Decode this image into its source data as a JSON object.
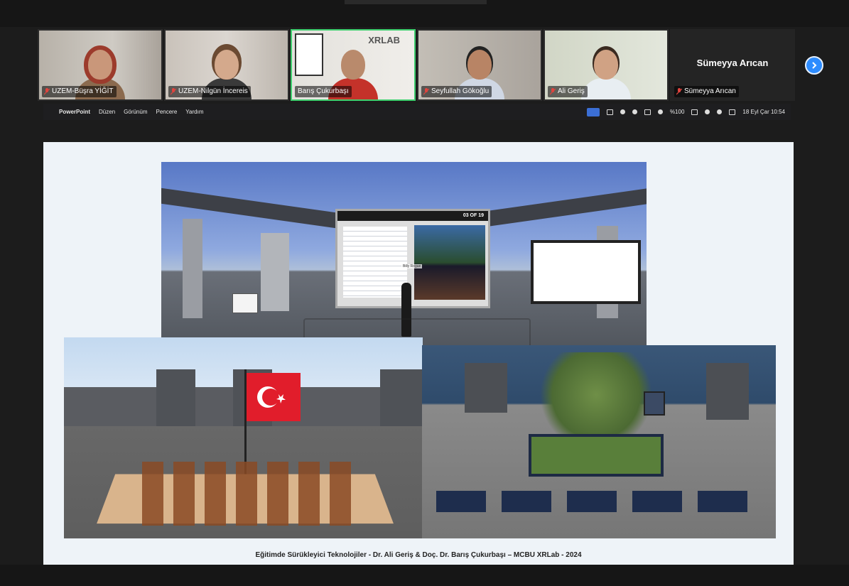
{
  "meeting": {
    "participants": [
      {
        "name": "UZEM-Büşra YİĞİT",
        "muted": true,
        "active": false,
        "skin": "#c9977a",
        "shirt": "#8b6a4e",
        "scarf": "#9c3b2c",
        "bg": "#bcb6ad"
      },
      {
        "name": "UZEM-Nilgün İncereis",
        "muted": true,
        "active": false,
        "skin": "#d4a98c",
        "shirt": "#3a3a3a",
        "bg": "#cfc9c3"
      },
      {
        "name": "Barış Çukurbaşı",
        "muted": false,
        "active": true,
        "skin": "#b98a6c",
        "shirt": "#c4322a",
        "bg": "#e6e4df",
        "poster_text": "XRLAB"
      },
      {
        "name": "Seyfullah Gökoğlu",
        "muted": true,
        "active": false,
        "skin": "#b88465",
        "shirt": "#cfd7e4",
        "bg": "#bdb8b0"
      },
      {
        "name": "Ali Geriş",
        "muted": true,
        "active": false,
        "skin": "#d0a284",
        "shirt": "#e8eef2",
        "bg": "#d8ddcf"
      }
    ],
    "text_only_participant": {
      "display": "Sümeyya Arıcan",
      "label": "Sümeyya Arıcan",
      "muted": true
    },
    "next_button": "›"
  },
  "menubar": {
    "apple": "",
    "app": "PowerPoint",
    "items": [
      "Düzen",
      "Görünüm",
      "Pencere",
      "Yardım"
    ],
    "battery": "%100",
    "datetime": "18 Eyl Çar  10:54"
  },
  "slide": {
    "caption": "Eğitimde Sürükleyici Teknolojiler - Dr. Ali Geriş & Doç. Dr. Barış Çukurbaşı – MCBU XRLab - 2024",
    "screenshot1": {
      "board_counter": "03 OF 19",
      "avatar_tag": "Billy Rogue"
    }
  },
  "colors": {
    "active_border": "#3ecf6e",
    "next_button": "#2d8cff",
    "menubar_bg": "#1e1e20",
    "slide_bg": "#eef3f8",
    "flag_red": "#e11d2b"
  }
}
